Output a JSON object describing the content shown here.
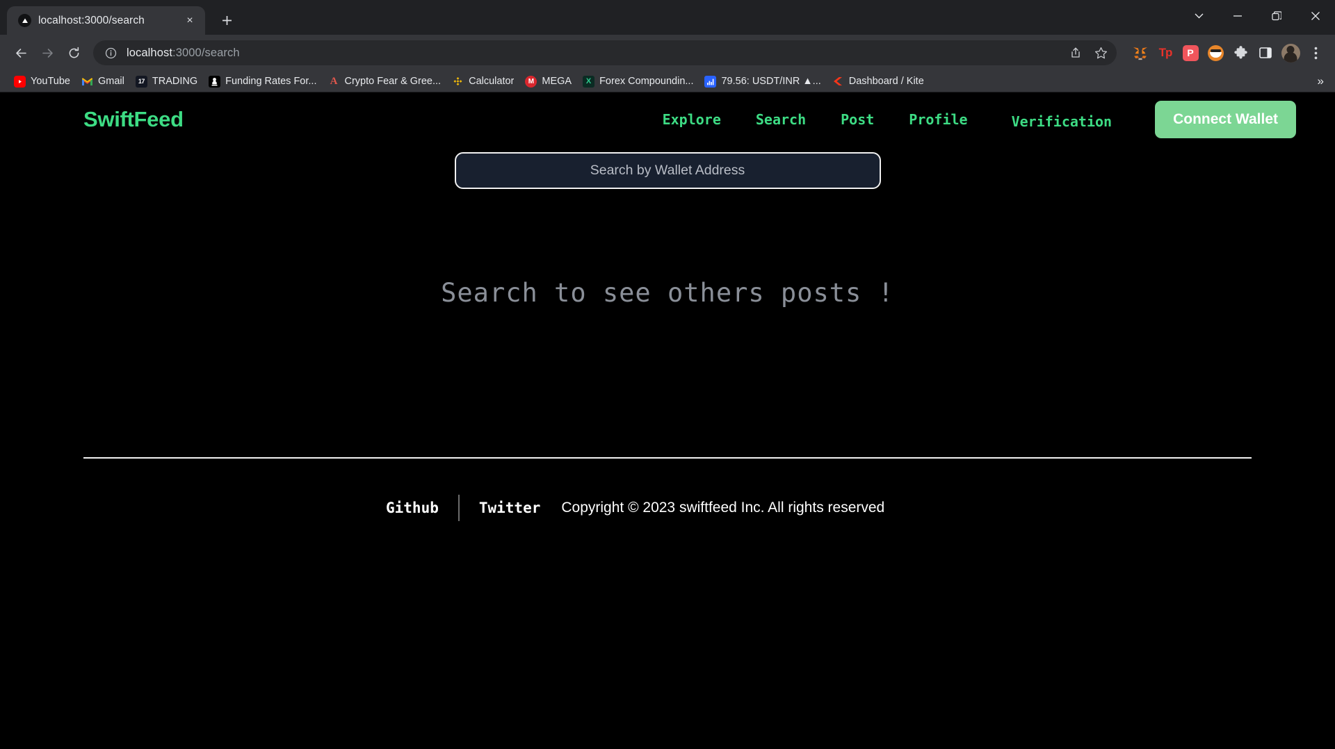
{
  "browser": {
    "tab": {
      "title": "localhost:3000/search",
      "favicon": "triangle-play-icon",
      "close_label": "×"
    },
    "new_tab_label": "+",
    "window_controls": [
      {
        "name": "tab-search",
        "glyph": "⌄"
      },
      {
        "name": "minimize",
        "glyph": "—"
      },
      {
        "name": "restore",
        "glyph": "❐"
      },
      {
        "name": "close",
        "glyph": "✕"
      }
    ],
    "toolbar": {
      "back_label": "←",
      "forward_label": "→",
      "reload_label": "⟳",
      "url_host": "localhost",
      "url_rest": ":3000/search",
      "site_info_icon": "info-circle-icon",
      "share_icon": "share-icon",
      "bookmark_icon": "star-icon",
      "menu_icon": "three-dot-menu-icon",
      "extensions": [
        {
          "name": "metamask-extension",
          "label": "🦊",
          "color": "#f5841f"
        },
        {
          "name": "tokenpocket-extension",
          "label": "Tp",
          "color": "#e8322a"
        },
        {
          "name": "phantom-extension",
          "label": "P",
          "color": "#f05a5a"
        },
        {
          "name": "shiba-extension",
          "label": "😎",
          "color": "#e8862a"
        },
        {
          "name": "extensions-puzzle",
          "label": "❖",
          "color": "#d7d9dd"
        },
        {
          "name": "side-panel",
          "label": "□",
          "color": "#e8eaed"
        }
      ],
      "profile_avatar": "user-avatar"
    },
    "bookmarks": [
      {
        "label": "YouTube",
        "icon": "youtube-icon",
        "bg": "#ff0000",
        "fg": "#ffffff",
        "glyph": "▶"
      },
      {
        "label": "Gmail",
        "icon": "gmail-icon",
        "bg": "#ffffff",
        "fg": "#ea4335",
        "glyph": "M"
      },
      {
        "label": "TRADING",
        "icon": "tradingview-icon",
        "bg": "#131722",
        "fg": "#ffffff",
        "glyph": "17"
      },
      {
        "label": "Funding Rates For...",
        "icon": "funding-rates-icon",
        "bg": "#000000",
        "fg": "#ffffff",
        "glyph": "♟"
      },
      {
        "label": "Crypto Fear & Gree...",
        "icon": "alternative-me-icon",
        "bg": "#000000",
        "fg": "#e2574c",
        "glyph": "A"
      },
      {
        "label": "Calculator",
        "icon": "binance-icon",
        "bg": "#000000",
        "fg": "#f0b90b",
        "glyph": "◈"
      },
      {
        "label": "MEGA",
        "icon": "mega-icon",
        "bg": "#d9272e",
        "fg": "#ffffff",
        "glyph": "M"
      },
      {
        "label": "Forex Compoundin...",
        "icon": "forex-icon",
        "bg": "#0b2b23",
        "fg": "#2ecc8f",
        "glyph": "X"
      },
      {
        "label": "79.56: USDT/INR ▲...",
        "icon": "usdt-inr-chart-icon",
        "bg": "#2962ff",
        "fg": "#ffffff",
        "glyph": "☰"
      },
      {
        "label": "Dashboard / Kite",
        "icon": "kite-icon",
        "bg": "#000000",
        "fg": "#f4361a",
        "glyph": "◀"
      }
    ],
    "bookmarks_overflow_label": "»"
  },
  "page": {
    "brand": "SwiftFeed",
    "nav": [
      {
        "id": "explore",
        "label": "Explore"
      },
      {
        "id": "search",
        "label": "Search"
      },
      {
        "id": "post",
        "label": "Post"
      },
      {
        "id": "profile",
        "label": "Profile"
      },
      {
        "id": "verification",
        "label": "Verification"
      }
    ],
    "connect_wallet_label": "Connect Wallet",
    "search": {
      "placeholder": "Search by Wallet Address",
      "value": ""
    },
    "empty_state": "Search to see others posts !",
    "footer": {
      "github_label": "Github",
      "twitter_label": "Twitter",
      "copyright": "Copyright © 2023 swiftfeed Inc. All rights reserved"
    },
    "colors": {
      "accent_green": "#3ddc84",
      "button_green": "#7cd694",
      "page_bg": "#000000",
      "input_bg": "#18202f",
      "muted_text": "#8a8f98"
    }
  }
}
